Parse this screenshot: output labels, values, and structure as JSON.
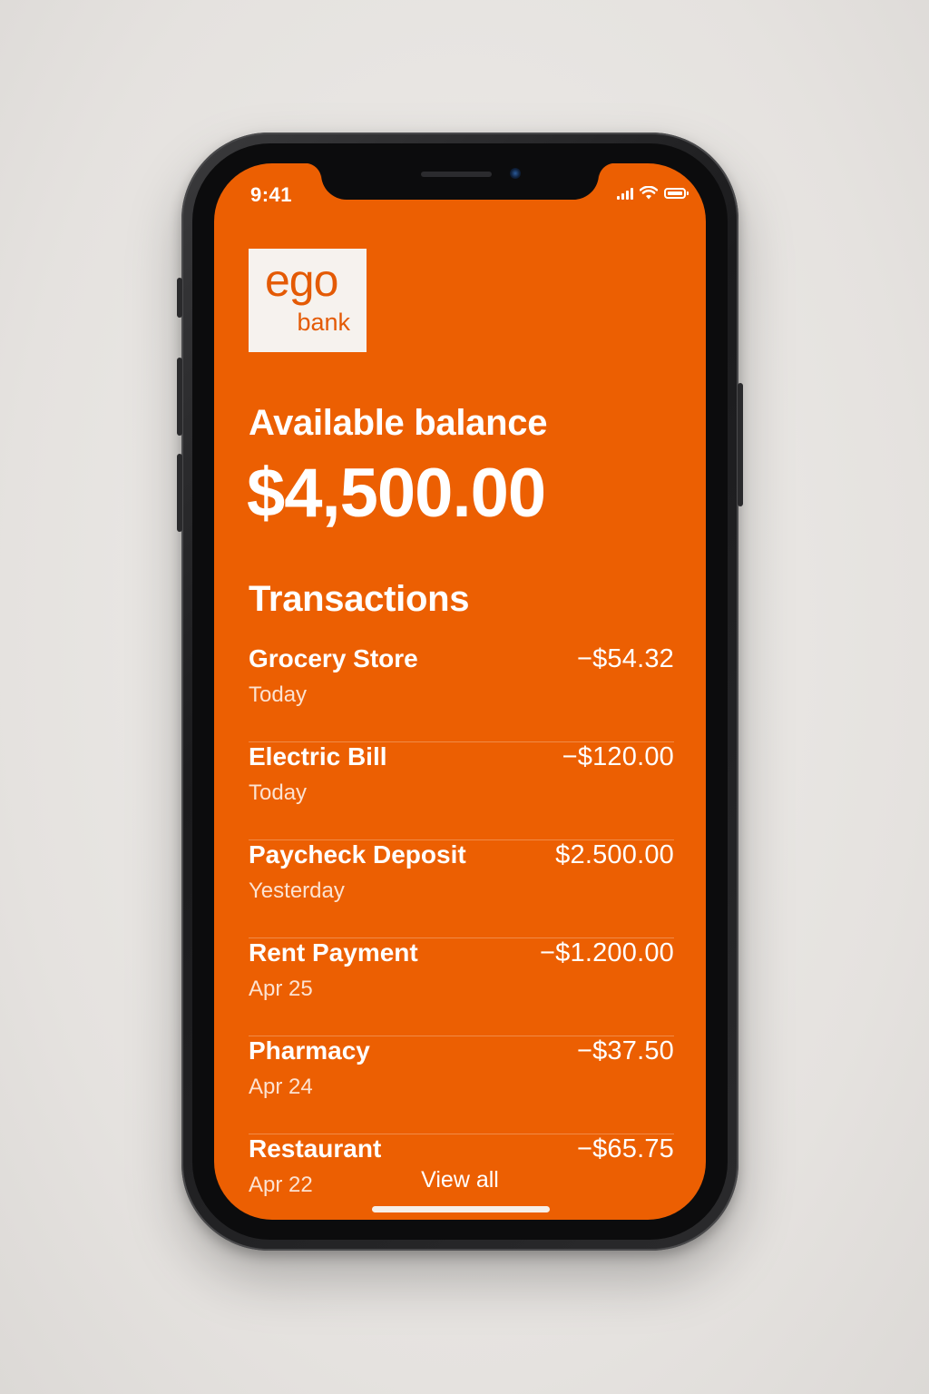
{
  "status_bar": {
    "time": "9:41",
    "icons": [
      "cellular-signal-icon",
      "wifi-icon",
      "battery-icon"
    ]
  },
  "brand": {
    "name": "ego",
    "subtitle": "bank",
    "primary_color": "#ec5f02",
    "logo_background": "#f6f2ee"
  },
  "balance": {
    "label": "Available balance",
    "value": "$4,500.00"
  },
  "transactions": {
    "title": "Transactions",
    "items": [
      {
        "name": "Grocery Store",
        "date": "Today",
        "amount": "−$54.32"
      },
      {
        "name": "Electric Bill",
        "date": "Today",
        "amount": "−$120.00"
      },
      {
        "name": "Paycheck Deposit",
        "date": "Yesterday",
        "amount": "$2.500.00"
      },
      {
        "name": "Rent Payment",
        "date": "Apr 25",
        "amount": "−$1.200.00"
      },
      {
        "name": "Pharmacy",
        "date": "Apr 24",
        "amount": "−$37.50"
      },
      {
        "name": "Restaurant",
        "date": "Apr 22",
        "amount": "−$65.75"
      }
    ],
    "view_all_label": "View all"
  }
}
